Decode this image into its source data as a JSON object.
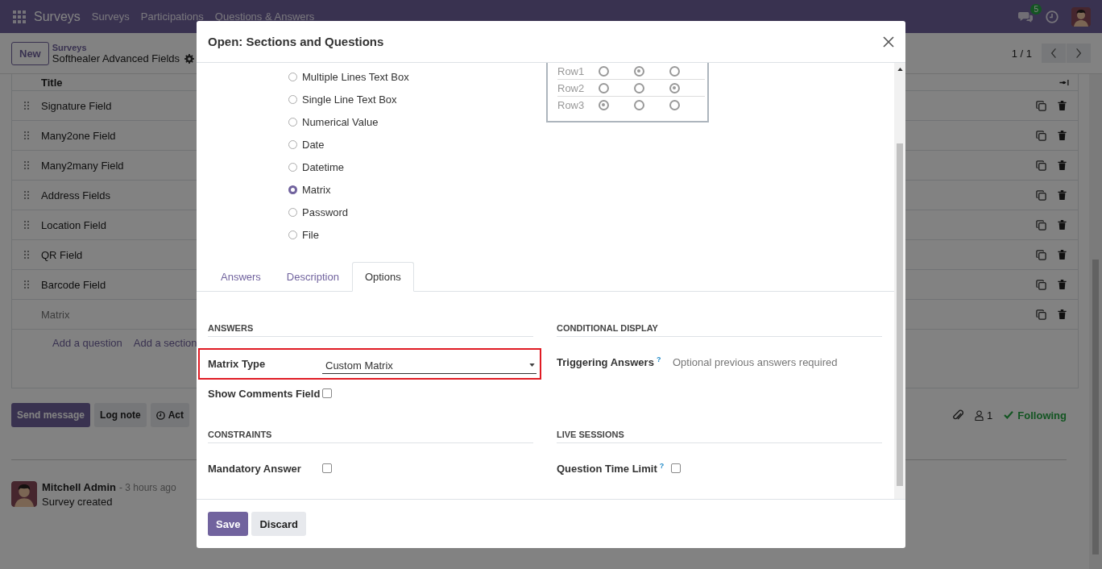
{
  "navbar": {
    "app_name": "Surveys",
    "menus": [
      "Surveys",
      "Participations",
      "Questions & Answers"
    ],
    "chat_badge": "5"
  },
  "control_panel": {
    "new_button": "New",
    "breadcrumb_parent": "Surveys",
    "breadcrumb_current": "Softhealer Advanced Fields",
    "pager": "1 / 1"
  },
  "question_list": {
    "header": "Title",
    "rows": [
      {
        "title": "Signature Field",
        "kind": "question"
      },
      {
        "title": "Many2one Field",
        "kind": "question"
      },
      {
        "title": "Many2many Field",
        "kind": "question"
      },
      {
        "title": "Address Fields",
        "kind": "question"
      },
      {
        "title": "Location Field",
        "kind": "question"
      },
      {
        "title": "QR Field",
        "kind": "question"
      },
      {
        "title": "Barcode Field",
        "kind": "question"
      },
      {
        "title": "Matrix",
        "kind": "new"
      }
    ],
    "add_links": [
      "Add a question",
      "Add a section"
    ]
  },
  "chatter": {
    "buttons": [
      {
        "label": "Send message",
        "kind": "primary"
      },
      {
        "label": "Log note",
        "kind": "secondary"
      },
      {
        "label": "Act",
        "kind": "activity"
      }
    ],
    "followers_count": "1",
    "follow_label": "Following",
    "messages": [
      {
        "author": "Mitchell Admin",
        "time": "- 3 hours ago",
        "body": "Survey created"
      }
    ]
  },
  "dialog": {
    "title": "Open: Sections and Questions",
    "question_types": [
      {
        "label": "Multiple Lines Text Box",
        "selected": false
      },
      {
        "label": "Single Line Text Box",
        "selected": false
      },
      {
        "label": "Numerical Value",
        "selected": false
      },
      {
        "label": "Date",
        "selected": false
      },
      {
        "label": "Datetime",
        "selected": false
      },
      {
        "label": "Matrix",
        "selected": true
      },
      {
        "label": "Password",
        "selected": false
      },
      {
        "label": "File",
        "selected": false
      }
    ],
    "matrix_preview": {
      "rows": [
        {
          "label": "Row1",
          "cells": [
            false,
            true,
            false
          ]
        },
        {
          "label": "Row2",
          "cells": [
            false,
            false,
            true
          ]
        },
        {
          "label": "Row3",
          "cells": [
            true,
            false,
            false
          ]
        }
      ]
    },
    "tabs": [
      {
        "label": "Answers",
        "selected": false
      },
      {
        "label": "Description",
        "selected": false
      },
      {
        "label": "Options",
        "selected": true
      }
    ],
    "sections": [
      {
        "heading": "ANSWERS",
        "fields": [
          {
            "kind": "select",
            "label": "Matrix Type",
            "value": "Custom Matrix",
            "highlighted": true
          },
          {
            "kind": "checkbox",
            "label": "Show Comments Field",
            "checked": false
          }
        ]
      },
      {
        "heading": "CONDITIONAL DISPLAY",
        "fields": [
          {
            "kind": "input",
            "label": "Triggering Answers",
            "help": "?",
            "placeholder": "Optional previous answers required"
          }
        ]
      },
      {
        "heading": "CONSTRAINTS",
        "fields": [
          {
            "kind": "checkbox",
            "label": "Mandatory Answer",
            "checked": false
          }
        ]
      },
      {
        "heading": "LIVE SESSIONS",
        "fields": [
          {
            "kind": "checkbox",
            "label": "Question Time Limit",
            "help": "?",
            "checked": false
          }
        ]
      }
    ],
    "buttons": [
      {
        "label": "Save",
        "kind": "primary"
      },
      {
        "label": "Discard",
        "kind": "secondary"
      }
    ]
  }
}
